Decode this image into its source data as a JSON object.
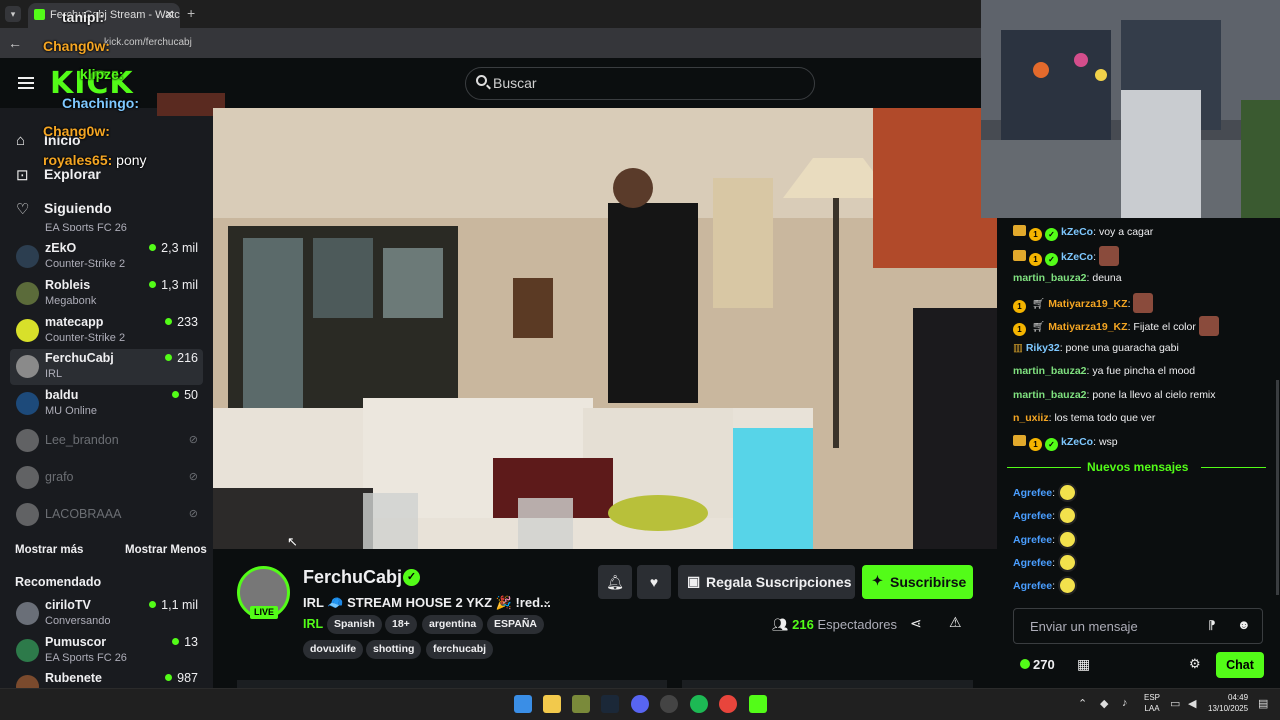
{
  "browser": {
    "tab_title": "FerchuCabj Stream - Watch Live",
    "url": "kick.com/ferchucabj",
    "new_tab": "+",
    "close": "✕"
  },
  "header": {
    "logo": "KICK",
    "search_placeholder": "Buscar"
  },
  "sidebar": {
    "nav": [
      {
        "label": "Inicio",
        "icon": "home-icon"
      },
      {
        "label": "Explorar",
        "icon": "compass-icon"
      },
      {
        "label": "Siguiendo",
        "icon": "heart-icon"
      }
    ],
    "partial_top": "EA Sports FC 26",
    "following": [
      {
        "name": "zEkO",
        "game": "Counter-Strike 2",
        "viewers": "2,3 mil"
      },
      {
        "name": "Robleis",
        "game": "Megabonk",
        "viewers": "1,3 mil"
      },
      {
        "name": "matecapp",
        "game": "Counter-Strike 2",
        "viewers": "233"
      },
      {
        "name": "FerchuCabj",
        "game": "IRL",
        "viewers": "216"
      },
      {
        "name": "baldu",
        "game": "MU Online",
        "viewers": "50"
      }
    ],
    "offline": [
      {
        "name": "Lee_brandon"
      },
      {
        "name": "grafo"
      },
      {
        "name": "LACOBRAAA"
      }
    ],
    "show_more": "Mostrar más",
    "show_less": "Mostrar Menos",
    "recommended_title": "Recomendado",
    "recommended": [
      {
        "name": "ciriloTV",
        "game": "Conversando",
        "viewers": "1,1 mil"
      },
      {
        "name": "Pumuscor",
        "game": "EA Sports FC 26",
        "viewers": "13"
      },
      {
        "name": "Rubenete",
        "game": "",
        "viewers": "987"
      }
    ]
  },
  "overlay_chat": [
    {
      "user": "tanipl:",
      "text": "",
      "color": "#f0f0f0"
    },
    {
      "user": "Chang0w:",
      "text": "",
      "color": "#f5a623"
    },
    {
      "user": "klipze:",
      "text": "",
      "color": "#53fc18"
    },
    {
      "user": "Chachingo:",
      "text": "",
      "color": "#7ec8ff"
    },
    {
      "user": "Chang0w:",
      "text": "",
      "color": "#f5a623"
    },
    {
      "user": "royales65:",
      "text": "pony",
      "color": "#f5a623"
    }
  ],
  "stream": {
    "channel": "FerchuCabj",
    "live": "LIVE",
    "title": "IRL 🧢 STREAM HOUSE 2 YKZ 🎉 !red...",
    "category": "IRL",
    "tags": [
      "Spanish",
      "18+",
      "argentina",
      "ESPAÑA",
      "dovuxlife",
      "shotting",
      "ferchucabj"
    ],
    "gift_label": "Regala Suscripciones",
    "subscribe_label": "Suscribirse",
    "viewers_count": "216",
    "viewers_label": "Espectadores"
  },
  "chat": {
    "messages": [
      {
        "user": "kZeCo",
        "text": "voy a cagar",
        "color": "#7ec8ff",
        "badges": "crown,1,check",
        "emote": ""
      },
      {
        "user": "kZeCo",
        "text": "",
        "color": "#7ec8ff",
        "badges": "crown,1,check",
        "emote": "pic"
      },
      {
        "user": "martin_bauza2",
        "text": "deuna",
        "color": "#7fe07f",
        "badges": "",
        "emote": ""
      },
      {
        "user": "Matiyarza19_KZ",
        "text": "",
        "color": "#f5a623",
        "badges": "1,cart",
        "emote": "pic"
      },
      {
        "user": "Matiyarza19_KZ",
        "text": "Fijate el color",
        "color": "#f5a623",
        "badges": "1,cart",
        "emote": "pic"
      },
      {
        "user": "Riky32",
        "text": "pone una guaracha gabi",
        "color": "#7ec8ff",
        "badges": "gift",
        "emote": ""
      },
      {
        "user": "martin_bauza2",
        "text": "ya fue pincha el mood",
        "color": "#7fe07f",
        "badges": "",
        "emote": ""
      },
      {
        "user": "martin_bauza2",
        "text": "pone la llevo al cielo remix",
        "color": "#7fe07f",
        "badges": "",
        "emote": ""
      },
      {
        "user": "n_uxiiz",
        "text": "los tema todo que ver",
        "color": "#f5a623",
        "badges": "",
        "emote": ""
      },
      {
        "user": "kZeCo",
        "text": "wsp",
        "color": "#7ec8ff",
        "badges": "crown,1,check",
        "emote": ""
      }
    ],
    "new_messages_label": "Nuevos mensajes",
    "new_messages": [
      {
        "user": "Agrefee",
        "color": "#4a9eff"
      },
      {
        "user": "Agrefee",
        "color": "#4a9eff"
      },
      {
        "user": "Agrefee",
        "color": "#4a9eff"
      },
      {
        "user": "Agrefee",
        "color": "#4a9eff"
      },
      {
        "user": "Agrefee",
        "color": "#4a9eff"
      }
    ],
    "input_placeholder": "Enviar un mensaje",
    "points": "270",
    "chat_button": "Chat"
  },
  "taskbar": {
    "lang_line1": "ESP",
    "lang_line2": "LAA",
    "time": "04:49",
    "date": "13/10/2025"
  },
  "colors": {
    "accent": "#53fc18",
    "bg": "#0b0e0f",
    "sidebar": "#191b1f"
  }
}
